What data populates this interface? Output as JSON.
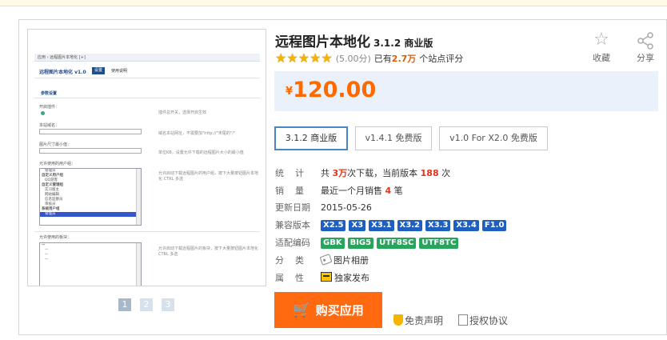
{
  "product": {
    "title": "远程图片本地化",
    "version_tag": "3.1.2 商业版",
    "rating_score": "(5.00分)",
    "rating_prefix": "已有",
    "rating_count": "2.7万",
    "rating_suffix": "个站点评分",
    "stars": 5,
    "currency": "¥",
    "price": "120.00"
  },
  "actions": {
    "favorite_label": "收藏",
    "share_label": "分享",
    "buy_label": "购买应用",
    "disclaimer_label": "免责声明",
    "license_label": "授权协议"
  },
  "versions": [
    {
      "label": "3.1.2 商业版",
      "active": true
    },
    {
      "label": "v1.4.1 免费版",
      "active": false
    },
    {
      "label": "v1.0 For X2.0 免费版",
      "active": false
    }
  ],
  "info": {
    "stats": {
      "key": "统计",
      "prefix": "共",
      "downloads": "3万",
      "mid": "次下载，当前版本",
      "current": "188",
      "suffix": "次"
    },
    "sales": {
      "key": "销量",
      "prefix": "最近一个月销售",
      "count": "4",
      "suffix": "笔"
    },
    "updated": {
      "key": "更新日期",
      "value": "2015-05-26"
    },
    "compat": {
      "key": "兼容版本",
      "items": [
        "X2.5",
        "X3",
        "X3.1",
        "X3.2",
        "X3.3",
        "X3.4",
        "F1.0"
      ]
    },
    "encoding": {
      "key": "适配编码",
      "items": [
        "GBK",
        "BIG5",
        "UTF8SC",
        "UTF8TC"
      ]
    },
    "category": {
      "key": "分类",
      "value": "图片相册"
    },
    "attribute": {
      "key": "属性",
      "value": "独家发布"
    }
  },
  "pager": [
    "1",
    "2",
    "3"
  ],
  "preview": {
    "breadcrumb": "应用 › 远程图片本地化 [+]",
    "title": "远程图片本地化 v1.0",
    "tab_active": "设置",
    "tab_other": "使用说明",
    "section": "参数设置",
    "rows": [
      {
        "label": "开启插件：",
        "hint": "插件总开关，选择开启生效"
      },
      {
        "label": "本站域名：",
        "hint": "域名本站网址，不需要加\"http://\"末尾的\"/\""
      },
      {
        "label": "图片尺寸最小值：",
        "hint": "单位KB，设置允许下载的远程图片大小的最小值"
      },
      {
        "label": "允许使用的用户组：",
        "hint": "允许启动下载远程图片的用户组，按下大量按钮图片本地化 CTRL 多选"
      },
      {
        "label": "允许使用的板块：",
        "hint": "允许启动下载远程图片的板块，按下大量按钮图片本地化 CTRL 多选"
      }
    ],
    "group_items": [
      "管理员",
      "超级版主",
      "自定义用户组",
      "QQ游客",
      "自定义管理组",
      "实习版主",
      "网站编辑",
      "信息监察员",
      "审核员",
      "系统用户组",
      "管理员"
    ]
  },
  "colors": {
    "price": "#ff6a00",
    "buy": "#ff6a10",
    "compat_badge": "#1f5fbf",
    "encoding_badge": "#28a45c",
    "price_bg": "#eaf1fa"
  }
}
